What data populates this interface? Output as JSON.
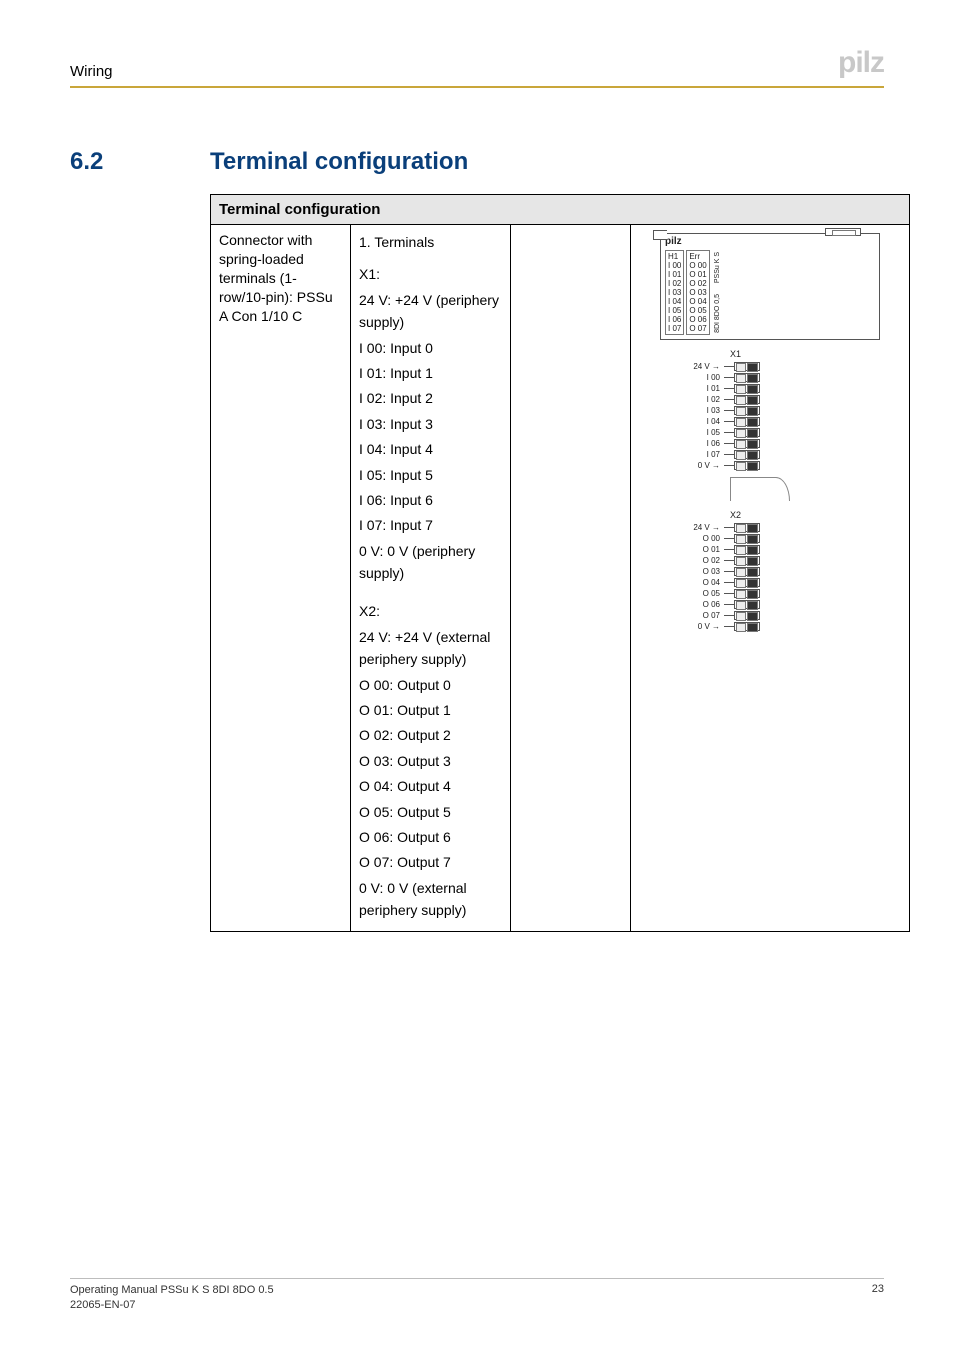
{
  "header": {
    "section": "Wiring",
    "logo": "pilz"
  },
  "section": {
    "num": "6.2",
    "title": "Terminal configuration"
  },
  "table": {
    "header": "Terminal configuration",
    "connector": "Connector with spring-loaded terminals (1-row/10-pin): PSSu A Con 1/10 C",
    "terms_heading": "1. Terminals",
    "x1_label": "X1:",
    "x1": [
      "24 V: +24 V (periphery supply)",
      "I 00: Input 0",
      "I 01: Input 1",
      "I 02: Input 2",
      "I 03: Input 3",
      "I 04: Input 4",
      "I 05: Input 5",
      "I 06: Input 6",
      "I 07: Input 7",
      "0 V: 0 V (periphery supply)"
    ],
    "x2_label": "X2:",
    "x2": [
      "24 V: +24 V (external periphery supply)",
      "O 00: Output 0",
      "O 01: Output 1",
      "O 02: Output 2",
      "O 03: Output 3",
      "O 04: Output 4",
      "O 05: Output 5",
      "O 06: Output 6",
      "O 07: Output 7",
      "0 V: 0 V (external periphery supply)"
    ]
  },
  "module": {
    "brand": "pilz",
    "side1": "PSSu K S",
    "side2": "8DI 8DO 0,5",
    "left_led_col": [
      "H1",
      "I 00",
      "I 01",
      "I 02",
      "I 03",
      "I 04",
      "I 05",
      "I 06",
      "I 07"
    ],
    "right_led_col": [
      "Err",
      "O 00",
      "O 01",
      "O 02",
      "O 03",
      "O 04",
      "O 05",
      "O 06",
      "O 07"
    ],
    "x1_block_label": "X1",
    "x1_rows": [
      "24 V",
      "I 00",
      "I 01",
      "I 02",
      "I 03",
      "I 04",
      "I 05",
      "I 06",
      "I 07",
      "0 V"
    ],
    "x2_block_label": "X2",
    "x2_rows": [
      "24 V",
      "O 00",
      "O 01",
      "O 02",
      "O 03",
      "O 04",
      "O 05",
      "O 06",
      "O 07",
      "0 V"
    ]
  },
  "footer": {
    "line1": "Operating Manual PSSu K S 8DI 8DO 0.5",
    "line2": "22065-EN-07",
    "page": "23"
  }
}
